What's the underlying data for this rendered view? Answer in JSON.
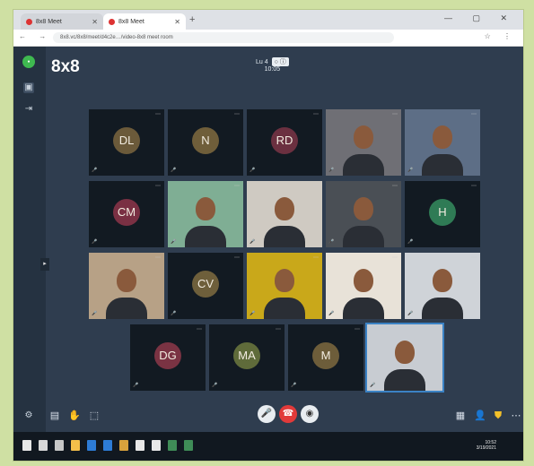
{
  "browser": {
    "tabs": [
      {
        "label": "8x8 Meet"
      },
      {
        "label": "8x8 Meet"
      }
    ],
    "url": "8x8.vc/8x8/meet/d4c2e…/video-8x8 meet room",
    "window_controls": "—  ▢  ✕"
  },
  "app": {
    "logo": "8x8",
    "meeting_title": "Lu 4",
    "meeting_badge": "○ ⓘ",
    "meeting_timer": "10:05"
  },
  "tiles": [
    {
      "initials": "DL",
      "color": "#6b5a3a",
      "row": 0,
      "col": 0
    },
    {
      "initials": "N",
      "color": "#6f5e3a",
      "row": 0,
      "col": 1
    },
    {
      "initials": "RD",
      "color": "#6b3040",
      "row": 0,
      "col": 2
    },
    {
      "initials": "",
      "color": "#6f6f75",
      "row": 0,
      "col": 3,
      "video": true
    },
    {
      "initials": "",
      "color": "#5d6e86",
      "row": 0,
      "col": 4,
      "video": true
    },
    {
      "initials": "CM",
      "color": "#7a3043",
      "row": 1,
      "col": 0
    },
    {
      "initials": "",
      "color": "#7fae94",
      "row": 1,
      "col": 1,
      "video": true
    },
    {
      "initials": "",
      "color": "#cfcac2",
      "row": 1,
      "col": 2,
      "video": true
    },
    {
      "initials": "",
      "color": "#4a4f55",
      "row": 1,
      "col": 3,
      "video": true
    },
    {
      "initials": "H",
      "color": "#2f7b55",
      "row": 1,
      "col": 4
    },
    {
      "initials": "",
      "color": "#b7a186",
      "row": 2,
      "col": 0,
      "video": true
    },
    {
      "initials": "CV",
      "color": "#6e5f3b",
      "row": 2,
      "col": 1
    },
    {
      "initials": "",
      "color": "#c9a81a",
      "row": 2,
      "col": 2,
      "video": true
    },
    {
      "initials": "",
      "color": "#e8e2d8",
      "row": 2,
      "col": 3,
      "video": true
    },
    {
      "initials": "",
      "color": "#cfd3d8",
      "row": 2,
      "col": 4,
      "video": true
    },
    {
      "initials": "DG",
      "color": "#7a3343",
      "row": 3,
      "col": 0
    },
    {
      "initials": "MA",
      "color": "#5f6b3a",
      "row": 3,
      "col": 1
    },
    {
      "initials": "M",
      "color": "#6d5d3a",
      "row": 3,
      "col": 2
    },
    {
      "initials": "",
      "color": "#c8ccd2",
      "row": 3,
      "col": 3,
      "video": true,
      "active": true
    }
  ],
  "controls": {
    "left": [
      "chat-icon",
      "raise-hand-icon",
      "share-icon"
    ],
    "center": [
      "mic-icon",
      "hangup-icon",
      "camera-icon"
    ],
    "right": [
      "grid-view-icon",
      "participants-icon",
      "security-icon",
      "more-icon"
    ]
  },
  "colors": {
    "app_bg": "#2f3d4f",
    "hangup": "#e23a3a",
    "accent": "#3b82c4"
  },
  "taskbar": {
    "clock_time": "10:52",
    "clock_date": "3/19/2021"
  }
}
